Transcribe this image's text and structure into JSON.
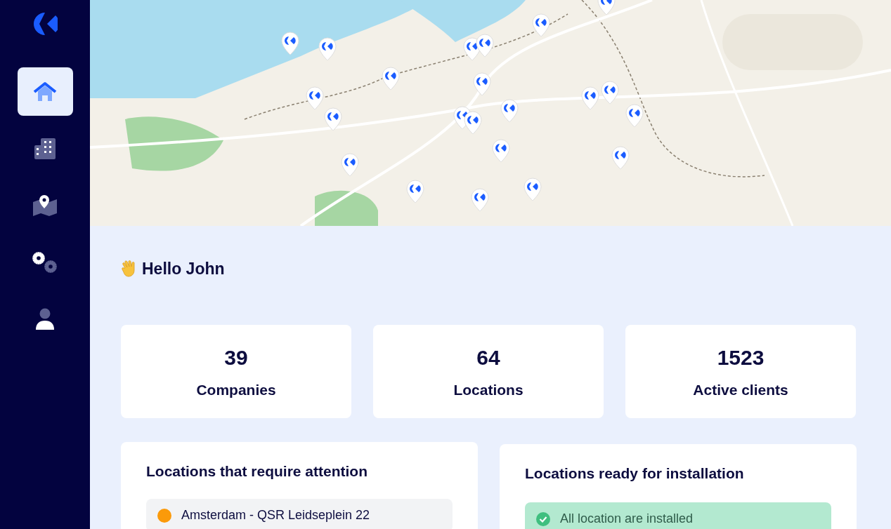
{
  "sidebar": {
    "items": [
      {
        "kind": "home",
        "selected": true
      },
      {
        "kind": "companies",
        "selected": false
      },
      {
        "kind": "map",
        "selected": false
      },
      {
        "kind": "settings",
        "selected": false
      },
      {
        "kind": "user",
        "selected": false
      }
    ]
  },
  "greeting": "Hello John",
  "stats": [
    {
      "value": "39",
      "label": "Companies"
    },
    {
      "value": "64",
      "label": "Locations"
    },
    {
      "value": "1523",
      "label": "Active clients"
    }
  ],
  "panels": [
    {
      "title": "Locations that require attention",
      "items": [
        {
          "kind": "warning",
          "text": "Amsterdam - QSR Leidseplein 22",
          "color": "#fb9a0a"
        }
      ]
    },
    {
      "title": "Locations ready for installation",
      "items": [
        {
          "kind": "success",
          "text": "All location are installed"
        }
      ]
    }
  ]
}
